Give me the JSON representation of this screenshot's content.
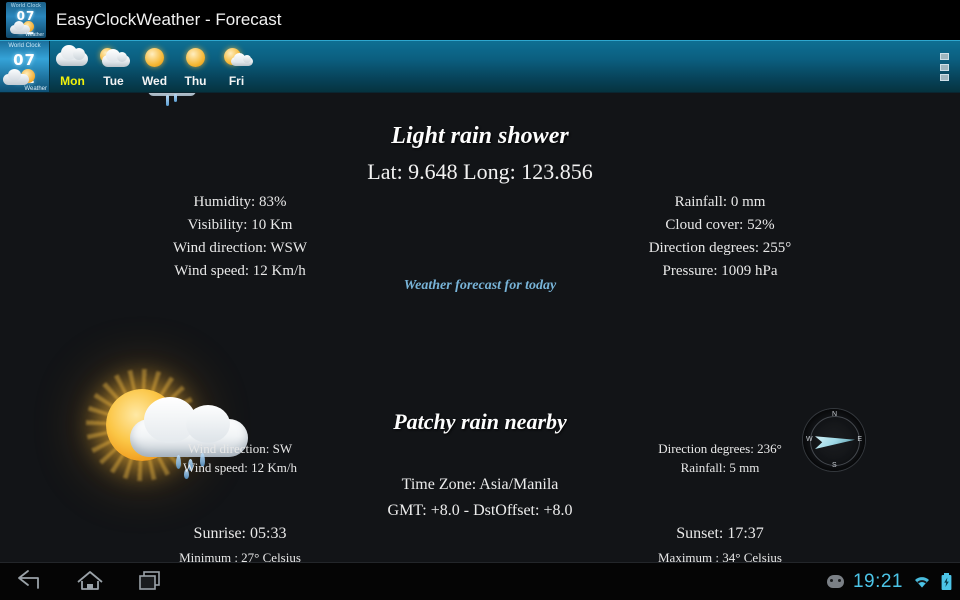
{
  "titlebar": {
    "app_title": "EasyClockWeather - Forecast",
    "app_icon_top": "World Clock",
    "app_icon_time": "07 12",
    "app_icon_bottom": "Weather"
  },
  "tabbar": {
    "app_icon_top": "World Clock",
    "app_icon_time": "07 12",
    "app_icon_bottom": "Weather",
    "tabs": [
      {
        "label": "Mon",
        "icon": "cloudy-icon",
        "active": true
      },
      {
        "label": "Tue",
        "icon": "sun-behind-cloud-icon",
        "active": false
      },
      {
        "label": "Wed",
        "icon": "sunny-icon",
        "active": false
      },
      {
        "label": "Thu",
        "icon": "sunny-icon",
        "active": false
      },
      {
        "label": "Fri",
        "icon": "sun-with-small-cloud-icon",
        "active": false
      }
    ],
    "overflow_menu": "overflow-menu-icon"
  },
  "forecast": {
    "today": {
      "condition": "Light rain shower",
      "latlong": "Lat: 9.648 Long: 123.856",
      "left": [
        "Humidity: 83%",
        "Visibility: 10 Km",
        "Wind direction: WSW",
        "Wind speed: 12 Km/h"
      ],
      "right": [
        "Rainfall: 0 mm",
        "Cloud cover: 52%",
        "Direction degrees: 255°",
        "Pressure: 1009 hPa"
      ],
      "link": "Weather forecast for today",
      "weather_icon": "sun-behind-rain-cloud-icon",
      "compass_icon": "compass-icon",
      "compass_labels": {
        "north": "N",
        "east": "E",
        "south": "S",
        "west": "W"
      }
    },
    "nearby": {
      "condition": "Patchy rain nearby",
      "left": [
        "Wind direction: SW",
        "Wind speed: 12 Km/h"
      ],
      "right": [
        "Direction degrees: 236°",
        "Rainfall: 5 mm"
      ],
      "timezone": [
        "Time Zone: Asia/Manila",
        "GMT: +8.0 - DstOffset: +8.0"
      ],
      "sun_left": [
        "Sunrise:  05:33",
        "Minimum : 27° Celsius"
      ],
      "sun_right": [
        "Sunset:  17:37",
        "Maximum : 34° Celsius"
      ]
    }
  },
  "systembar": {
    "back": "back-icon",
    "home": "home-icon",
    "recents": "recent-apps-icon",
    "notification_icon": "cyanogenmod-icon",
    "clock": "19:21",
    "wifi": "wifi-icon",
    "battery": "battery-charging-icon"
  },
  "colors": {
    "accent_tab_active": "#f2f20c",
    "link": "#78b4d8",
    "clock": "#4cc5e8",
    "tabbar_gradient_top": "#0e6f93"
  }
}
